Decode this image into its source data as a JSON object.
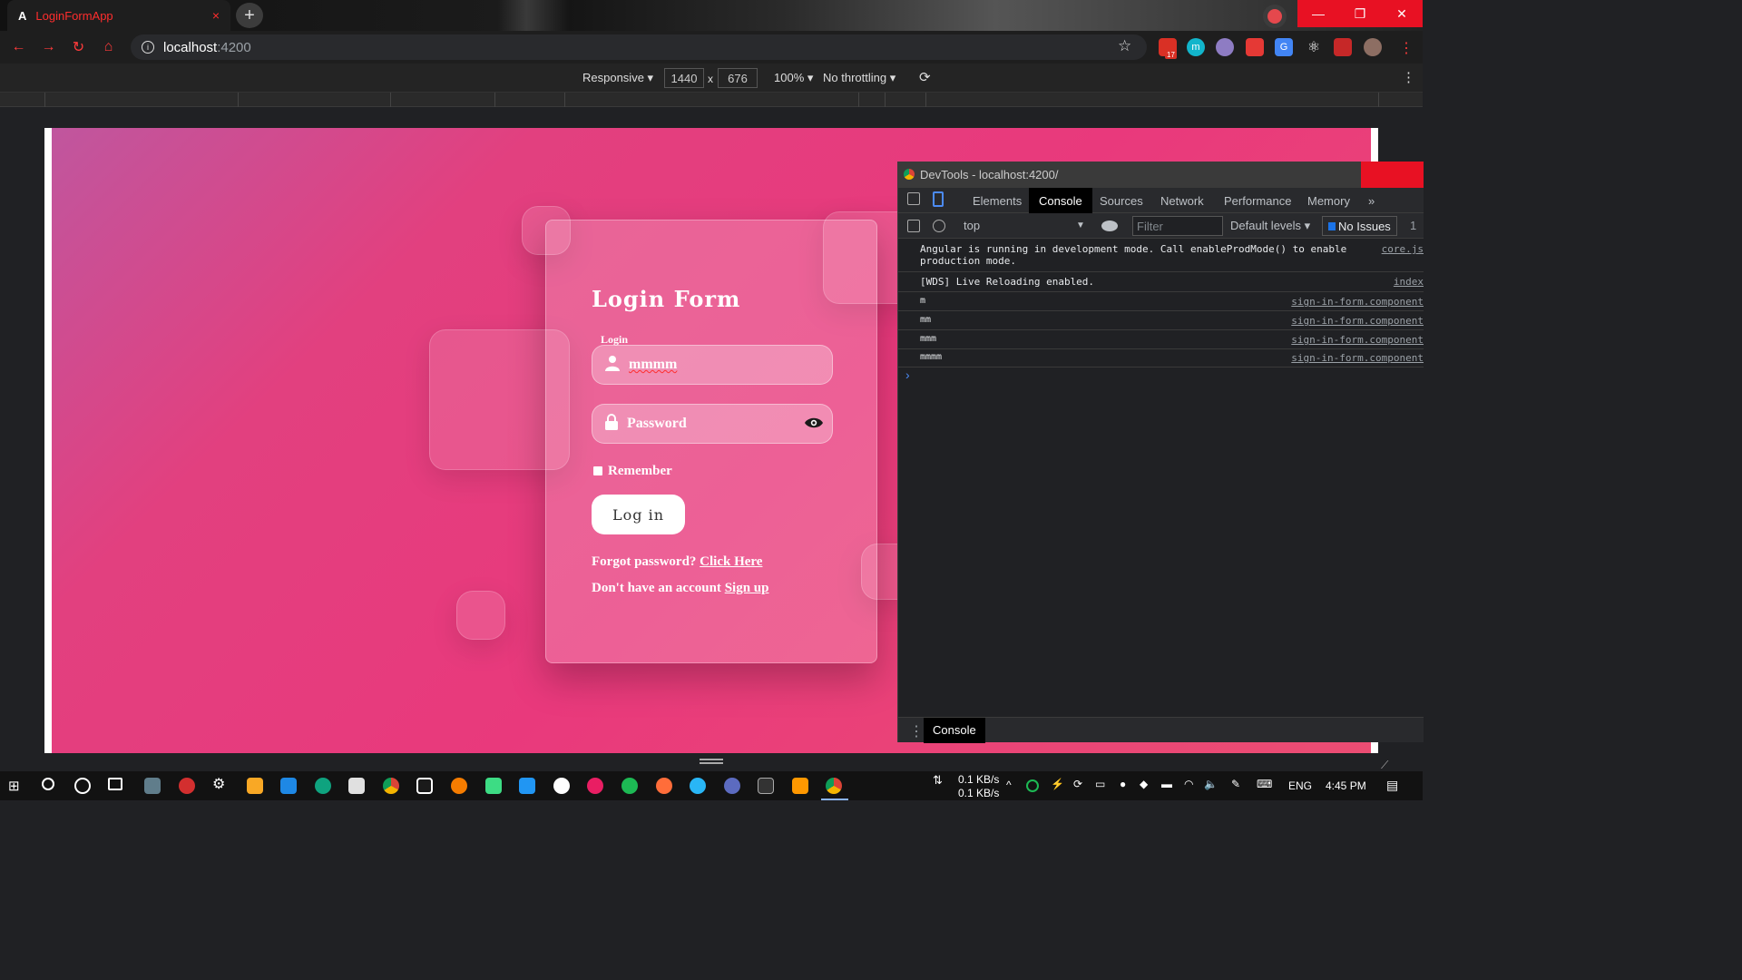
{
  "browser": {
    "tab_title": "LoginFormApp",
    "tab_close": "×",
    "new_tab": "+",
    "url_host": "localhost",
    "url_port": ":4200",
    "window_controls": [
      "—",
      "❐",
      "✕"
    ],
    "extension_badge": "17"
  },
  "device_toolbar": {
    "mode": "Responsive ▾",
    "width": "1440",
    "times": "x",
    "height": "676",
    "zoom": "100% ▾",
    "throttling": "No throttling ▾"
  },
  "login": {
    "title": "Login Form",
    "login_label": "Login",
    "login_value": "mmmm",
    "password_placeholder": "Password",
    "remember_label": "Remember",
    "login_button": "Log in",
    "forgot_text": "Forgot password?",
    "forgot_link": "Click Here",
    "signup_text": "Don't have an account",
    "signup_link": "Sign up"
  },
  "devtools": {
    "window_title": "DevTools - localhost:4200/",
    "tabs": [
      "Elements",
      "Console",
      "Sources",
      "Network",
      "Performance",
      "Memory",
      "»"
    ],
    "active_tab": "Console",
    "context": "top",
    "filter_placeholder": "Filter",
    "levels": "Default levels ▾",
    "issues": "No Issues",
    "issues_count": "1",
    "messages": [
      {
        "text": "Angular is running in development mode. Call enableProdMode() to enable production mode.",
        "source": "core.js"
      },
      {
        "text": "[WDS] Live Reloading enabled.",
        "source": "index"
      },
      {
        "text": "m",
        "source": "sign-in-form.component"
      },
      {
        "text": "mm",
        "source": "sign-in-form.component"
      },
      {
        "text": "mmm",
        "source": "sign-in-form.component"
      },
      {
        "text": "mmmm",
        "source": "sign-in-form.component"
      }
    ],
    "prompt": "›",
    "drawer_tab": "Console"
  },
  "taskbar": {
    "net_down": "0.1 KB/s",
    "net_up": "0.1 KB/s",
    "lang": "ENG",
    "time": "4:45 PM"
  },
  "colors": {
    "accent_red": "#e81123",
    "page_gradient_start": "#c0569e",
    "page_gradient_end": "#eb4d73"
  }
}
